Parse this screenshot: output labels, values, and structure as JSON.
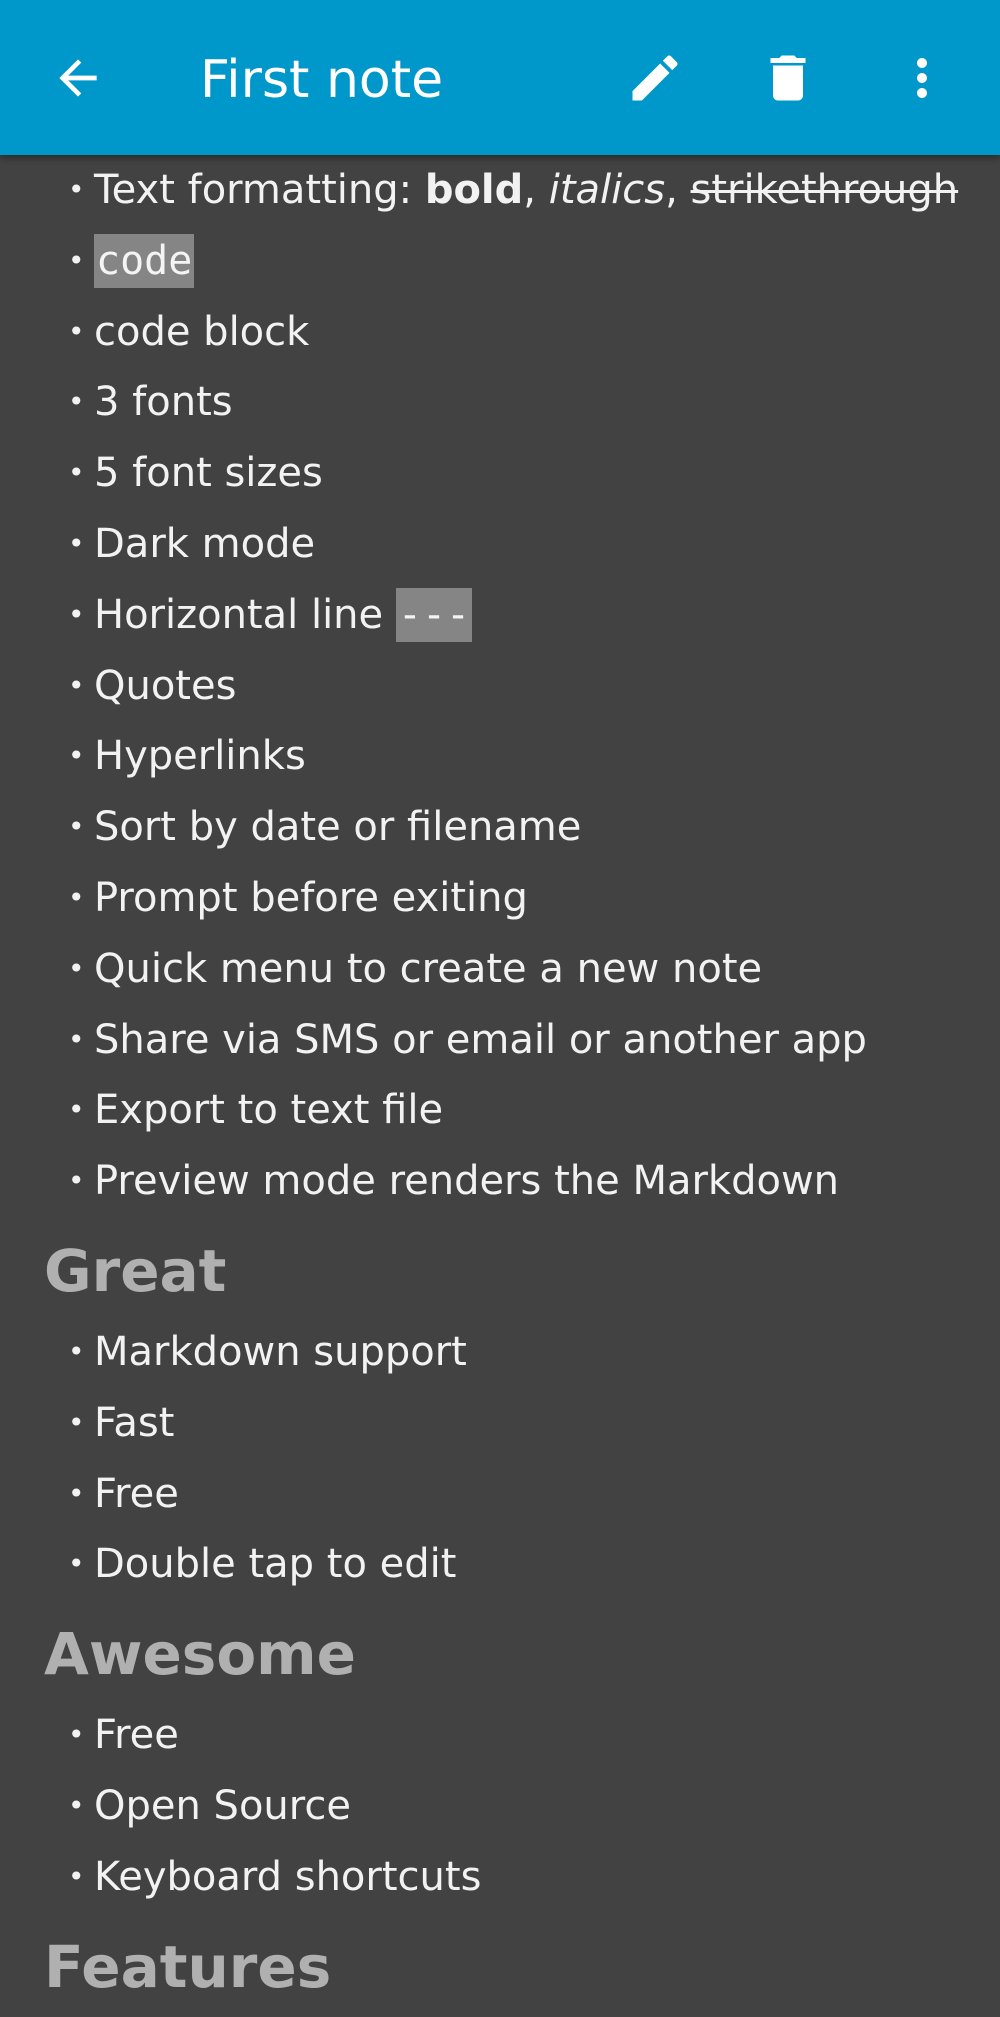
{
  "appbar": {
    "title": "First note",
    "background": "#0098cb",
    "icons": {
      "back": "arrow-back-icon",
      "edit": "pencil-icon",
      "delete": "trash-icon",
      "more": "more-vertical-icon"
    }
  },
  "note": {
    "list_formatting": {
      "prefix": "Text formatting: ",
      "bold": "bold",
      "sep1": ", ",
      "italic": "italics",
      "sep2": ", ",
      "strike": "strikethrough"
    },
    "code_item": "code",
    "features_1": [
      "code block",
      "3 fonts",
      "5 font sizes",
      "Dark mode"
    ],
    "hr_item": {
      "label": "Horizontal line ",
      "code": "---"
    },
    "features_2": [
      "Quotes",
      "Hyperlinks",
      "Sort by date or filename",
      "Prompt before exiting",
      "Quick menu to create a new note",
      "Share via SMS or email or another app",
      "Export to text file",
      "Preview mode renders the Markdown"
    ],
    "heading_great": "Great",
    "great_items": [
      "Markdown support",
      "Fast",
      "Free",
      "Double tap to edit"
    ],
    "heading_awesome": "Awesome",
    "awesome_items": [
      "Free",
      "Open Source",
      "Keyboard shortcuts"
    ],
    "heading_features": "Features"
  }
}
